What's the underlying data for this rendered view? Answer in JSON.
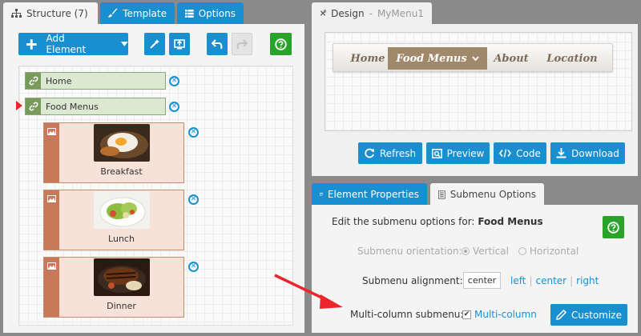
{
  "structure_tab": {
    "label": "Structure (7)",
    "icon": "sitemap-icon"
  },
  "template_tab": {
    "label": "Template",
    "icon": "brush-icon"
  },
  "options_tab": {
    "label": "Options",
    "icon": "list-icon"
  },
  "toolbar": {
    "add_element_label": "Add Element"
  },
  "tree": {
    "items": [
      {
        "label": "Home"
      },
      {
        "label": "Food Menus"
      }
    ],
    "cards": [
      {
        "caption": "Breakfast"
      },
      {
        "caption": "Lunch"
      },
      {
        "caption": "Dinner"
      }
    ]
  },
  "design": {
    "title": "Design",
    "sep": "-",
    "menu_name": "MyMenu1",
    "menu": [
      "Home",
      "Food Menus",
      "About",
      "Location"
    ],
    "buttons": {
      "refresh": "Refresh",
      "preview": "Preview",
      "code": "Code",
      "download": "Download"
    }
  },
  "props": {
    "tab_element": "Element Properties",
    "tab_submenu": "Submenu Options",
    "edit_prefix": "Edit the submenu options for:",
    "edit_target": "Food Menus",
    "orientation_label": "Submenu orientation:",
    "orientation_vertical": "Vertical",
    "orientation_horizontal": "Horizontal",
    "alignment_label": "Submenu alignment:",
    "alignment_value": "center",
    "align_left": "left",
    "align_center": "center",
    "align_right": "right",
    "align_sep": "|",
    "multicolumn_label": "Multi-column submenu:",
    "multicolumn_checkbox": "Multi-column",
    "customize": "Customize"
  },
  "colors": {
    "accent_blue": "#1a8fd0",
    "help_green": "#2aa32a",
    "arrow_red": "#e8262b"
  }
}
